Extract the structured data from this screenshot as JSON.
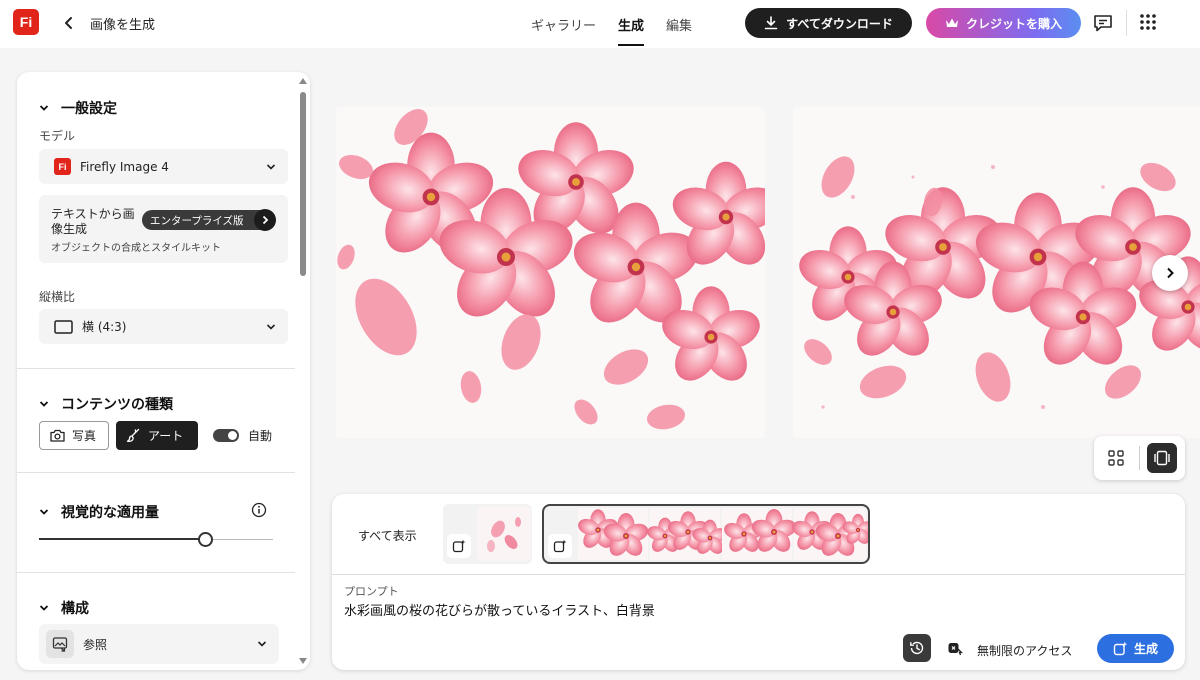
{
  "header": {
    "logo_text": "Fi",
    "page_title": "画像を生成",
    "tabs": [
      {
        "label": "ギャラリー",
        "active": false
      },
      {
        "label": "生成",
        "active": true
      },
      {
        "label": "編集",
        "active": false
      }
    ],
    "download_all_label": "すべてダウンロード",
    "buy_credits_label": "クレジットを購入"
  },
  "sidebar": {
    "general": {
      "title": "一般設定",
      "model_label": "モデル",
      "model_value": "Firefly Image 4",
      "t2i_title": "テキストから画像生成",
      "t2i_badge": "エンタープライズ版",
      "t2i_subtitle": "オブジェクトの合成とスタイルキット",
      "aspect_label": "縦横比",
      "aspect_value": "横 (4:3)"
    },
    "content_type": {
      "title": "コンテンツの種類",
      "photo_label": "写真",
      "art_label": "アート",
      "auto_label": "自動",
      "selected": "アート"
    },
    "visual_intensity": {
      "title": "視覚的な適用量",
      "value": 0.71
    },
    "composition": {
      "title": "構成",
      "reference_label": "参照"
    }
  },
  "prompt_panel": {
    "show_all_label": "すべて表示",
    "prompt_label": "プロンプト",
    "prompt_text": "水彩画風の桜の花びらが散っているイラスト、白背景",
    "unlimited_label": "無制限のアクセス",
    "generate_label": "生成"
  },
  "colors": {
    "brand_red": "#e1251b",
    "generate_blue": "#2b6fe0",
    "dark": "#1f1f1f",
    "petal_pink": "#f07a90"
  },
  "icons": [
    "back-icon",
    "download-icon",
    "crown-icon",
    "chat-icon",
    "apps-grid-icon",
    "chevron-down-icon",
    "chevron-right-icon",
    "camera-icon",
    "brush-icon",
    "info-icon",
    "reference-icon",
    "grid-view-icon",
    "single-view-icon",
    "history-icon",
    "unlimited-icon",
    "sparkle-generate-icon"
  ]
}
